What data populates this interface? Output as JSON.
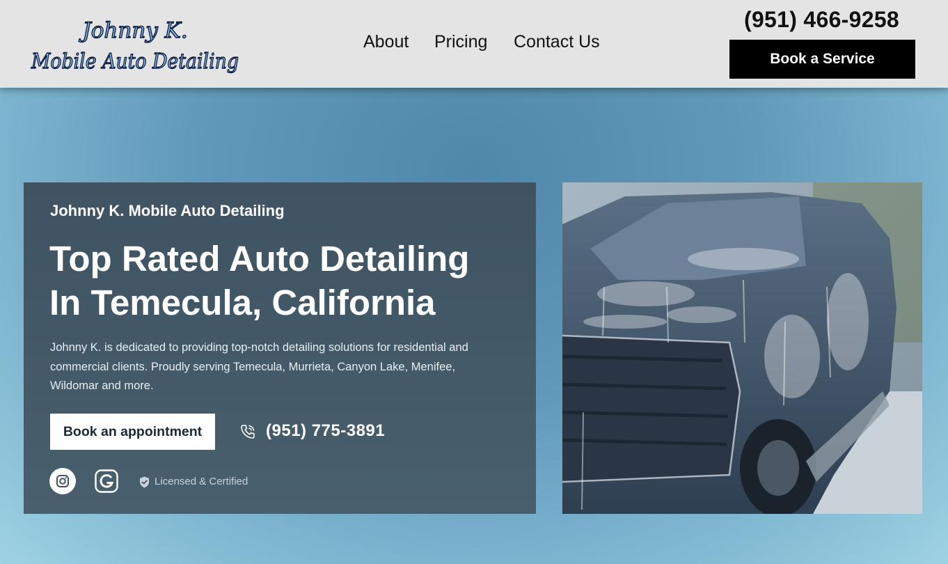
{
  "header": {
    "logo_line1": "Johnny K.",
    "logo_line2": "Mobile Auto Detailing",
    "nav": [
      "About",
      "Pricing",
      "Contact Us"
    ],
    "phone": "(951) 466-9258",
    "book_label": "Book a Service"
  },
  "hero": {
    "eyebrow": "Johnny K. Mobile Auto Detailing",
    "title_line1": "Top Rated Auto Detailing",
    "title_line2": "In Temecula, California",
    "description": "Johnny K. is dedicated to providing top-notch detailing solutions for residential and commercial clients. Proudly serving Temecula, Murrieta, Canyon Lake, Menifee, Wildomar and more.",
    "appointment_label": "Book an appointment",
    "phone": "(951) 775-3891",
    "badge": "Licensed & Certified"
  },
  "icons": {
    "phone": "phone-icon",
    "instagram": "instagram-icon",
    "google": "google-icon",
    "shield": "shield-check-icon"
  },
  "colors": {
    "header_bg": "#e4e4e4",
    "book_button_bg": "#000000",
    "hero_card_bg": "#445a68",
    "logo_fill": "#8fc3ea"
  }
}
